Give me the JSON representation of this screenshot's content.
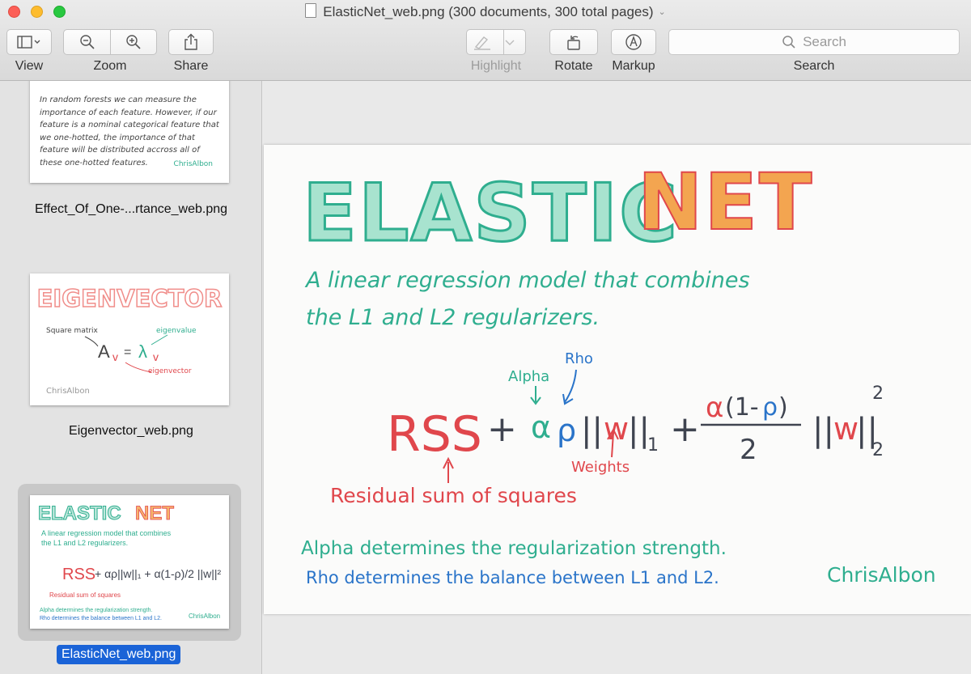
{
  "window": {
    "title": "ElasticNet_web.png (300 documents, 300 total pages)"
  },
  "toolbar": {
    "view_label": "View",
    "zoom_label": "Zoom",
    "share_label": "Share",
    "highlight_label": "Highlight",
    "rotate_label": "Rotate",
    "markup_label": "Markup",
    "search_placeholder": "Search",
    "search_label": "Search"
  },
  "sidebar": {
    "items": [
      {
        "label": "Effect_Of_One-...rtance_web.png",
        "text": "In random forests we can measure the importance of each feature. However, if our feature is a nominal categorical feature that we one-hotted, the importance of that feature will be distributed accross all of these one-hotted features.",
        "signature": "ChrisAlbon"
      },
      {
        "label": "Eigenvector_web.png",
        "title": "EIGENVECTOR",
        "square_matrix": "Square matrix",
        "eigenvalue": "eigenvalue",
        "eigenvector": "eigenvector",
        "signature": "ChrisAlbon"
      },
      {
        "label": "ElasticNet_web.png",
        "selected": true
      }
    ]
  },
  "page": {
    "title_elastic": "ELASTIC",
    "title_net": "NET",
    "subtitle_line1": "A linear regression model that combines",
    "subtitle_line2": "the L1 and L2 regularizers.",
    "rss": "RSS",
    "alpha_label": "Alpha",
    "rho_label": "Rho",
    "weights_label": "Weights",
    "residual_label": "Residual sum of squares",
    "footer_line1": "Alpha determines the regularization strength.",
    "footer_line2": "Rho determines the balance between L1 and L2.",
    "signature": "ChrisAlbon"
  },
  "colors": {
    "teal": "#2fae8f",
    "orange": "#f0963a",
    "blue": "#2a74c9",
    "red": "#e0474c",
    "dark": "#3f4450",
    "selection": "#1a63d7"
  }
}
